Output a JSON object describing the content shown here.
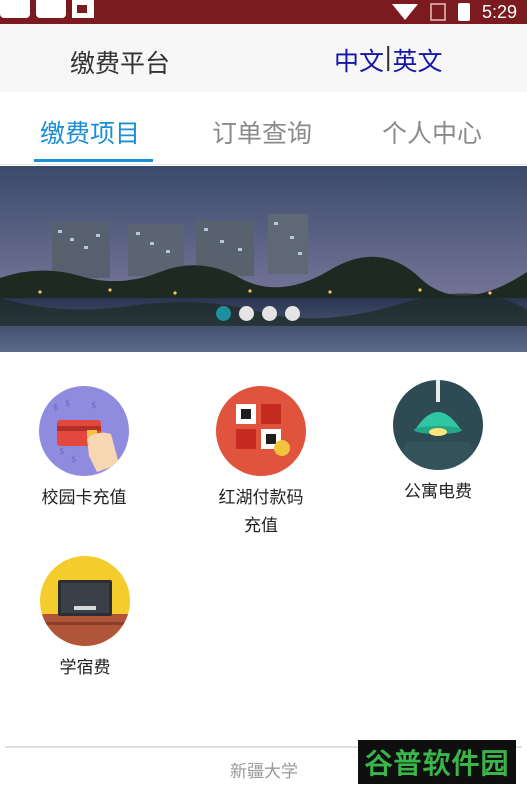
{
  "status_bar": {
    "time": "5:29"
  },
  "header": {
    "title": "缴费平台",
    "lang_zh": "中文",
    "lang_sep": "|",
    "lang_en": "英文"
  },
  "tabs": [
    {
      "label": "缴费项目",
      "active": true
    },
    {
      "label": "订单查询",
      "active": false
    },
    {
      "label": "个人中心",
      "active": false
    }
  ],
  "banner": {
    "slide_count": 4,
    "active_index": 0
  },
  "items": [
    {
      "label_line1": "校园卡充值",
      "label_line2": "",
      "icon": "campus-card-icon"
    },
    {
      "label_line1": "红湖付款码",
      "label_line2": "充值",
      "icon": "qr-code-icon"
    },
    {
      "label_line1": "公寓电费",
      "label_line2": "",
      "icon": "ceiling-lamp-icon"
    },
    {
      "label_line1": "学宿费",
      "label_line2": "",
      "icon": "blackboard-icon"
    }
  ],
  "footer": {
    "text": "新疆大学"
  },
  "watermark": {
    "text": "谷普软件园"
  },
  "colors": {
    "status_bar": "#7b1b1f",
    "accent": "#1a8fd6",
    "lang_link": "#1515a8",
    "watermark_green": "#3ab54a"
  }
}
